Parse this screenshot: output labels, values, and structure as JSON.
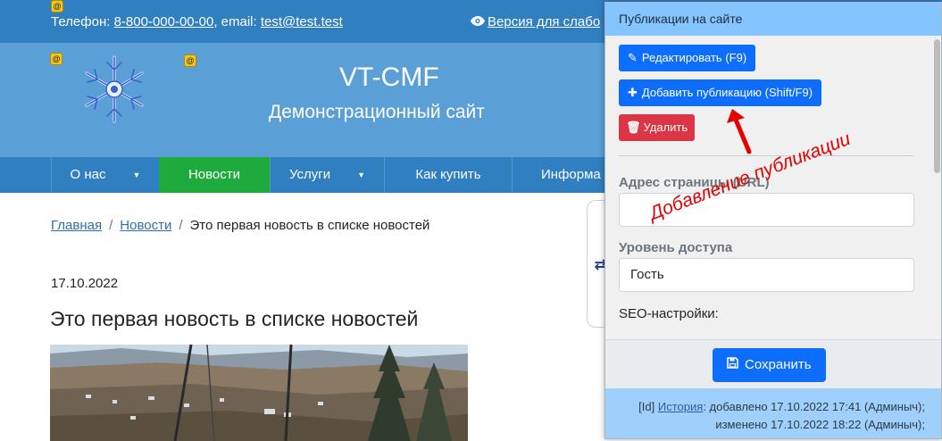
{
  "topbar": {
    "phone_label": "Телефон:",
    "phone": "8-800-000-00-00",
    "email_label": ", email:",
    "email": "test@test.test",
    "accessible_version": "Версия для слабо"
  },
  "header": {
    "site_title": "VT-CMF",
    "site_subtitle": "Демонстрационный сайт"
  },
  "nav": {
    "items": [
      {
        "label": "О нас",
        "has_dropdown": true
      },
      {
        "label": "Новости",
        "active": true
      },
      {
        "label": "Услуги",
        "has_dropdown": true
      },
      {
        "label": "Как купить"
      },
      {
        "label": "Информа"
      }
    ]
  },
  "breadcrumb": {
    "home": "Главная",
    "news": "Новости",
    "current": "Это первая новость в списке новостей"
  },
  "article": {
    "date": "17.10.2022",
    "title": "Это первая новость в списке новостей"
  },
  "panel": {
    "title": "Публикации на сайте",
    "edit_button": "Редактировать (F9)",
    "add_button": "Добавить публикацию (Shift/F9)",
    "delete_button": "Удалить",
    "address_label": "Адрес страницы (URL)",
    "address_value": "",
    "access_label": "Уровень доступа",
    "access_value": "Гость",
    "seo_label": "SEO-настройки:",
    "save_button": "Сохранить",
    "info_prefix": "[Id]",
    "history_link": "История",
    "info_added": ": добавлено 17.10.2022 17:41 (Админыч);",
    "info_changed": "изменено 17.10.2022 18:22 (Админыч);"
  },
  "annotation": {
    "text": "Добавление публикации"
  },
  "colors": {
    "topbar": "#2f7fc1",
    "header": "#5aa0d6",
    "nav_active": "#1eaa3c",
    "panel_header": "#84c4ff",
    "primary_button": "#0d6efd",
    "danger_button": "#dc3545",
    "annotation": "#e50000"
  },
  "icons": {
    "edit": "pencil-square-icon",
    "add": "plus-icon",
    "delete": "trash-icon",
    "save": "floppy-disk-icon",
    "accessible": "eye-icon",
    "toggle": "swap-arrows-icon"
  }
}
